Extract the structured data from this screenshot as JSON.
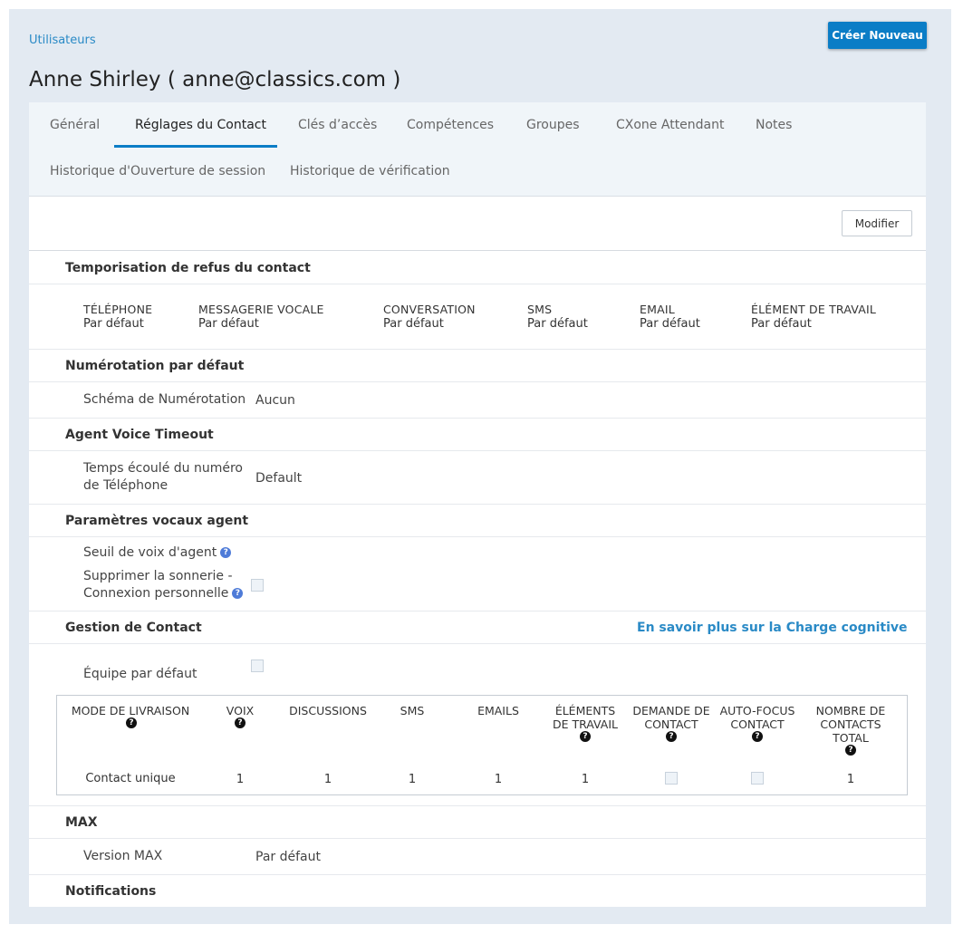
{
  "header": {
    "breadcrumb": "Utilisateurs",
    "create_label": "Créer Nouveau",
    "title": "Anne Shirley ( anne@classics.com )"
  },
  "tabs": [
    {
      "label": "Général"
    },
    {
      "label": "Réglages du Contact",
      "active": true
    },
    {
      "label": "Clés d’accès"
    },
    {
      "label": "Compétences"
    },
    {
      "label": "Groupes"
    },
    {
      "label": "CXone Attendant"
    },
    {
      "label": "Notes"
    },
    {
      "label": "Historique d'Ouverture de session"
    },
    {
      "label": "Historique de vérification"
    }
  ],
  "toolbar": {
    "edit_label": "Modifier"
  },
  "refusal": {
    "title": "Temporisation de refus du contact",
    "columns": [
      {
        "name": "TÉLÉPHONE",
        "value": "Par défaut"
      },
      {
        "name": "MESSAGERIE VOCALE",
        "value": "Par défaut"
      },
      {
        "name": "CONVERSATION",
        "value": "Par défaut"
      },
      {
        "name": "SMS",
        "value": "Par défaut"
      },
      {
        "name": "EMAIL",
        "value": "Par défaut"
      },
      {
        "name": "ÉLÉMENT DE TRAVAIL",
        "value": "Par défaut"
      }
    ]
  },
  "dialing": {
    "title": "Numérotation par défaut",
    "label": "Schéma de Numérotation",
    "value": "Aucun"
  },
  "voice_timeout": {
    "title": "Agent Voice Timeout",
    "label_line1": "Temps écoulé du numéro",
    "label_line2": "de Téléphone",
    "value": "Default"
  },
  "voice_params": {
    "title": "Paramètres vocaux agent",
    "threshold_label": "Seuil de voix d'agent",
    "suppress_line1": "Supprimer la sonnerie -",
    "suppress_line2": "Connexion personnelle",
    "suppress_checked": false
  },
  "contact_mgmt": {
    "title": "Gestion de Contact",
    "link": "En savoir plus sur la Charge cognitive",
    "default_team_label": "Équipe par défaut",
    "default_team_checked": false,
    "table": {
      "headers": [
        {
          "line1": "MODE DE LIVRAISON",
          "line2": "",
          "line3": "",
          "help": true
        },
        {
          "line1": "VOIX",
          "line2": "",
          "line3": "",
          "help": true
        },
        {
          "line1": "DISCUSSIONS",
          "line2": "",
          "line3": "",
          "help": false
        },
        {
          "line1": "SMS",
          "line2": "",
          "line3": "",
          "help": false
        },
        {
          "line1": "EMAILS",
          "line2": "",
          "line3": "",
          "help": false
        },
        {
          "line1": "ÉLÉMENTS",
          "line2": "DE TRAVAIL",
          "line3": "",
          "help": true
        },
        {
          "line1": "DEMANDE DE",
          "line2": "CONTACT",
          "line3": "",
          "help": true
        },
        {
          "line1": "AUTO-FOCUS",
          "line2": "CONTACT",
          "line3": "",
          "help": true
        },
        {
          "line1": "NOMBRE DE",
          "line2": "CONTACTS",
          "line3": "TOTAL",
          "help": true
        }
      ],
      "row": {
        "mode": "Contact unique",
        "voice": "1",
        "discussions": "1",
        "sms": "1",
        "emails": "1",
        "work_items": "1",
        "contact_request": false,
        "auto_focus": false,
        "total": "1"
      }
    }
  },
  "max": {
    "title": "MAX",
    "label": "Version MAX",
    "value": "Par défaut"
  },
  "notifications": {
    "title": "Notifications"
  },
  "icons": {
    "help": "question-circle-icon"
  },
  "colors": {
    "accent": "#0b7dc6",
    "link": "#2a8ac6",
    "help": "#4e7bd8"
  }
}
